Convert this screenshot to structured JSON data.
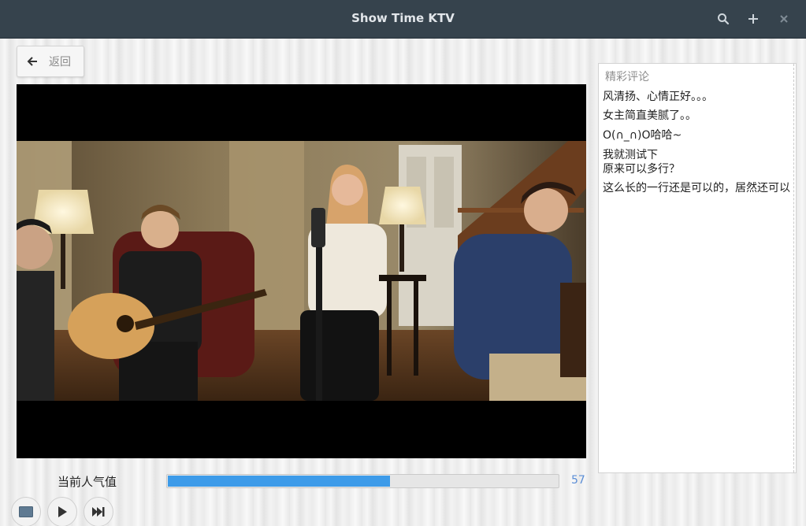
{
  "window": {
    "title": "Show Time KTV",
    "search_icon": "search-icon",
    "add_icon": "plus-icon",
    "close_icon": "close-icon"
  },
  "back_button": {
    "label": "返回",
    "icon": "arrow-left-icon"
  },
  "comments": {
    "title": "精彩评论",
    "items": [
      "风清扬、心情正好。。。",
      "女主简直美腻了。。",
      "O(∩_∩)O哈哈~",
      "我就测试下",
      "原来可以多行？",
      "这么长的一行还是可以的，居然还可以"
    ]
  },
  "popularity": {
    "label": "当前人气值",
    "value": "57",
    "fill_fraction": 0.57
  },
  "controls": {
    "stop_icon": "stop-icon",
    "play_icon": "play-icon",
    "next_icon": "skip-next-icon"
  },
  "colors": {
    "titlebar": "#36434d",
    "progress": "#3d9be9",
    "value_text": "#5b8ed6"
  }
}
